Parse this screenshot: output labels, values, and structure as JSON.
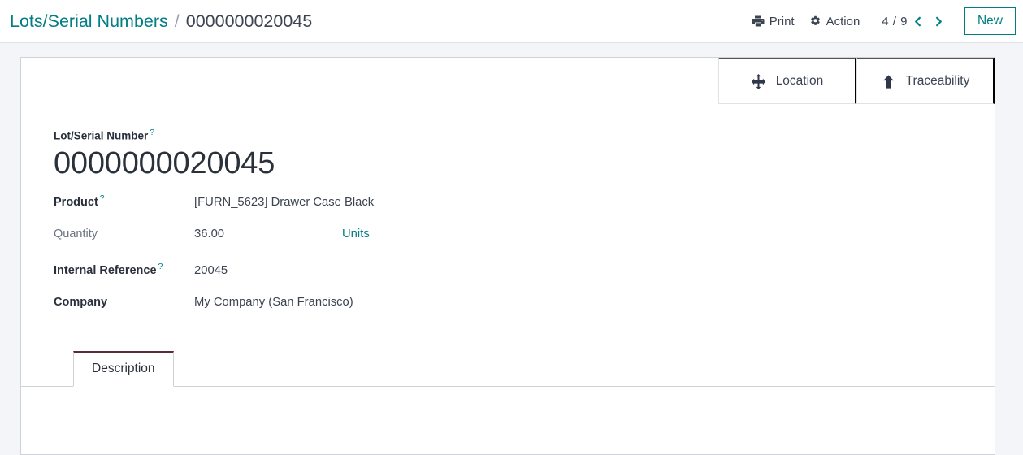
{
  "breadcrumb": {
    "parent": "Lots/Serial Numbers",
    "separator": "/",
    "current": "0000000020045"
  },
  "control_panel": {
    "print_label": "Print",
    "action_label": "Action",
    "pager": "4 / 9",
    "new_label": "New",
    "icons": {
      "print": "printer-icon",
      "action": "gear-icon",
      "prev": "chevron-left-icon",
      "next": "chevron-right-icon"
    }
  },
  "smart_buttons": [
    {
      "label": "Location",
      "icon": "arrows-move-icon"
    },
    {
      "label": "Traceability",
      "icon": "arrow-up-icon"
    }
  ],
  "form": {
    "title_label": "Lot/Serial Number",
    "title_tooltip": "?",
    "title_value": "0000000020045",
    "fields": [
      {
        "label": "Product",
        "tooltip": "?",
        "value": "[FURN_5623] Drawer Case Black"
      },
      {
        "label": "Quantity",
        "tooltip": "",
        "value": "36.00",
        "uom": "Units"
      },
      {
        "label": "Internal Reference",
        "tooltip": "?",
        "value": "20045"
      },
      {
        "label": "Company",
        "tooltip": "",
        "value": "My Company (San Francisco)"
      }
    ]
  },
  "notebook": {
    "tabs": [
      {
        "label": "Description"
      }
    ],
    "active_page_content": ""
  },
  "colors": {
    "accent": "#017e84",
    "text": "#3c4452",
    "muted": "#6b7280",
    "page_bg": "#f4f5f8",
    "border": "#cfd3d9",
    "tab_active_top": "#5c2b38"
  }
}
